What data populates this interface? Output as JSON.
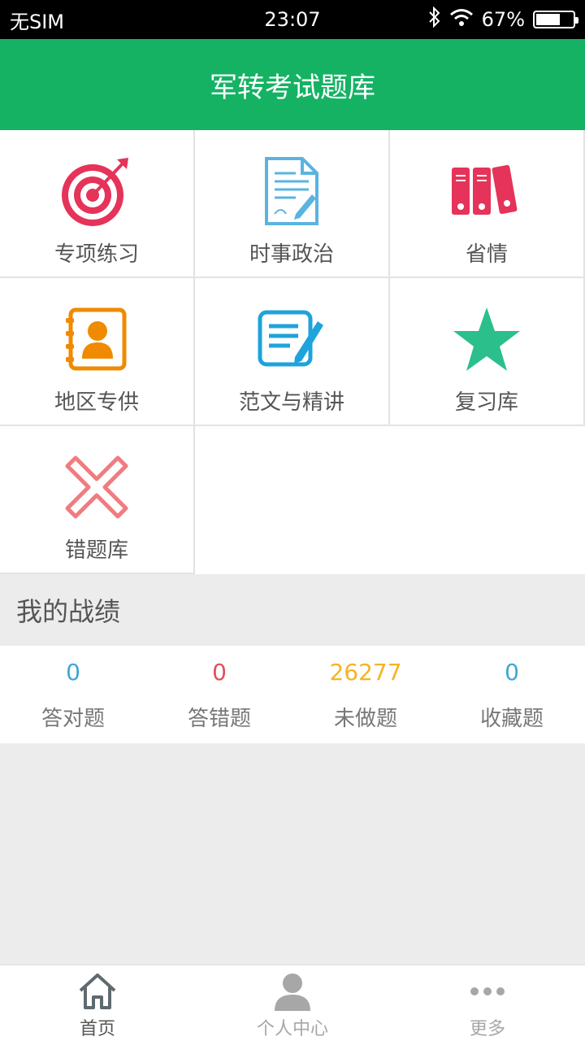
{
  "status_bar": {
    "carrier": "无SIM",
    "time": "23:07",
    "battery_text": "67%",
    "battery_level": 0.67
  },
  "header": {
    "title": "军转考试题库"
  },
  "grid": {
    "items": [
      {
        "label": "专项练习",
        "icon": "target-icon"
      },
      {
        "label": "时事政治",
        "icon": "document-pen-icon"
      },
      {
        "label": "省情",
        "icon": "binders-icon"
      },
      {
        "label": "地区专供",
        "icon": "contact-book-icon"
      },
      {
        "label": "范文与精讲",
        "icon": "edit-note-icon"
      },
      {
        "label": "复习库",
        "icon": "star-icon"
      },
      {
        "label": "错题库",
        "icon": "x-mark-icon"
      }
    ]
  },
  "record": {
    "title": "我的战绩",
    "stats": [
      {
        "value": "0",
        "label": "答对题",
        "color": "#3fa7d6"
      },
      {
        "value": "0",
        "label": "答错题",
        "color": "#e0505c"
      },
      {
        "value": "26277",
        "label": "未做题",
        "color": "#f5b323"
      },
      {
        "value": "0",
        "label": "收藏题",
        "color": "#3fa7d6"
      }
    ]
  },
  "tabbar": {
    "items": [
      {
        "label": "首页",
        "icon": "home-icon",
        "active": true
      },
      {
        "label": "个人中心",
        "icon": "user-icon",
        "active": false
      },
      {
        "label": "更多",
        "icon": "more-icon",
        "active": false
      }
    ]
  },
  "colors": {
    "brand": "#15b264",
    "tab_active": "#555555",
    "tab_inactive": "#a7a7a7"
  }
}
